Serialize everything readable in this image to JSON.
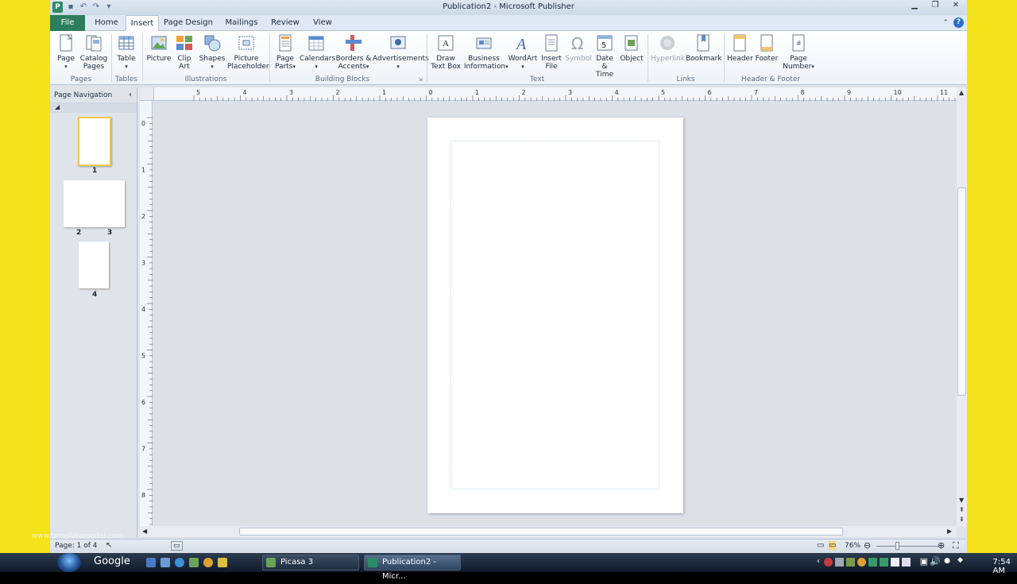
{
  "window": {
    "title": "Publication2  -  Microsoft Publisher",
    "app_icon_letter": "P"
  },
  "tabs": [
    "File",
    "Home",
    "Insert",
    "Page Design",
    "Mailings",
    "Review",
    "View"
  ],
  "active_tab": "Insert",
  "ribbon": {
    "buttons": {
      "page": "Page",
      "catalog_pages_1": "Catalog",
      "catalog_pages_2": "Pages",
      "table": "Table",
      "picture": "Picture",
      "clip_art_1": "Clip",
      "clip_art_2": "Art",
      "shapes": "Shapes",
      "picture_placeholder_1": "Picture",
      "picture_placeholder_2": "Placeholder",
      "page_parts_1": "Page",
      "page_parts_2": "Parts",
      "calendars": "Calendars",
      "borders_accents_1": "Borders &",
      "borders_accents_2": "Accents",
      "advertisements": "Advertisements",
      "draw_text_box_1": "Draw",
      "draw_text_box_2": "Text Box",
      "business_info_1": "Business",
      "business_info_2": "Information",
      "wordart": "WordArt",
      "insert_file_1": "Insert",
      "insert_file_2": "File",
      "symbol": "Symbol",
      "date_time_1": "Date",
      "date_time_2": "& Time",
      "object": "Object",
      "hyperlink": "Hyperlink",
      "bookmark": "Bookmark",
      "header": "Header",
      "footer": "Footer",
      "page_number_1": "Page",
      "page_number_2": "Number"
    },
    "groups": {
      "pages": "Pages",
      "tables": "Tables",
      "illustrations": "Illustrations",
      "building_blocks": "Building Blocks",
      "text": "Text",
      "links": "Links",
      "header_footer": "Header & Footer"
    }
  },
  "nav_pane": {
    "title": "Page Navigation",
    "page_labels": [
      "1",
      "2",
      "3",
      "4"
    ]
  },
  "rulers": {
    "h_labels": [
      "5",
      "4",
      "3",
      "2",
      "1",
      "0",
      "1",
      "2",
      "3",
      "4",
      "5",
      "6",
      "7",
      "8",
      "9",
      "10",
      "11"
    ],
    "v_labels": [
      "0",
      "1",
      "2",
      "3",
      "4",
      "5",
      "6",
      "7",
      "8"
    ]
  },
  "status": {
    "page": "Page: 1 of 4",
    "zoom": "76%"
  },
  "taskbar": {
    "search": "Google",
    "items": [
      "Picasa 3",
      "Publication2 - Micr..."
    ],
    "time": "7:54 AM"
  },
  "watermark": "www.templatemodel.com"
}
